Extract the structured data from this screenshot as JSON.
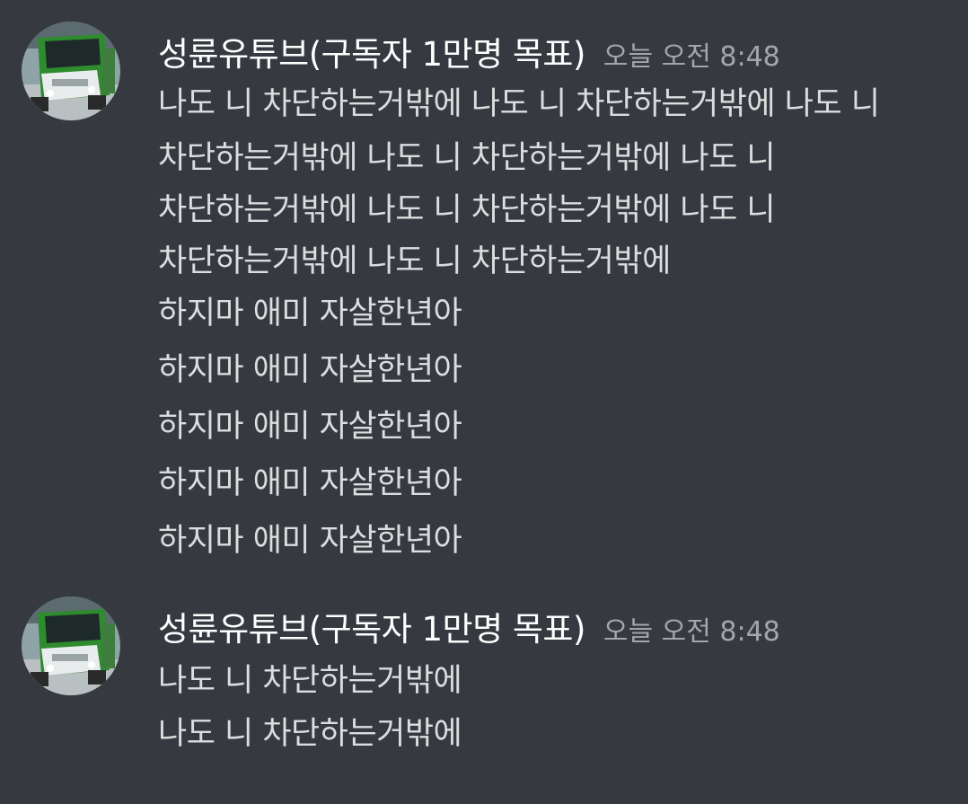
{
  "colors": {
    "background": "#36393f",
    "username": "#ffffff",
    "timestamp": "#a3a6aa",
    "message_text": "#dcddde",
    "avatar_bus_green": "#2e8b2e"
  },
  "messages": [
    {
      "avatar_icon": "green-bus-avatar-icon",
      "username": "성륜유튜브(구독자 1만명 목표)",
      "timestamp": "오늘 오전 8:48",
      "lines": [
        "나도 니 차단하는거밖에 나도 니 차단하는거밖에 나도 니",
        "차단하는거밖에 나도 니 차단하는거밖에 나도 니",
        "차단하는거밖에 나도 니 차단하는거밖에 나도 니",
        "차단하는거밖에 나도 니 차단하는거밖에",
        "하지마 애미 자살한년아",
        "하지마 애미 자살한년아",
        "하지마 애미 자살한년아",
        "하지마 애미 자살한년아",
        "하지마 애미 자살한년아"
      ]
    },
    {
      "avatar_icon": "green-bus-avatar-icon",
      "username": "성륜유튜브(구독자 1만명 목표)",
      "timestamp": "오늘 오전 8:48",
      "lines": [
        "나도 니 차단하는거밖에",
        "나도 니 차단하는거밖에"
      ]
    }
  ]
}
